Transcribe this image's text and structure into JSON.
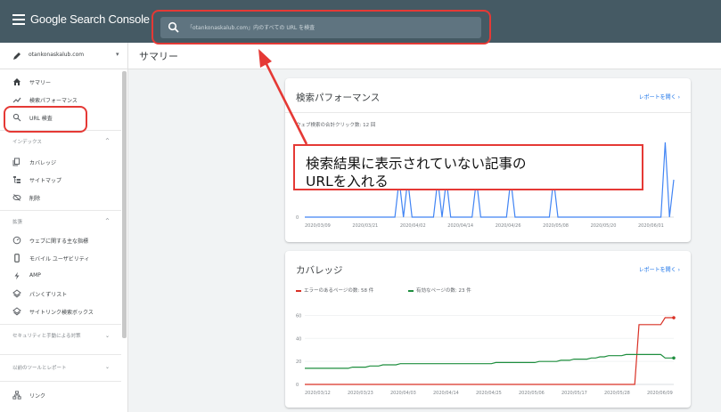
{
  "app": {
    "title": "Google Search Console"
  },
  "search": {
    "placeholder": "「otankonaskalub.com」内のすべての URL を検査"
  },
  "property": {
    "label": "otankonaskalub.com"
  },
  "sidebar": {
    "top_items": [
      {
        "label": "サマリー",
        "icon": "home-icon"
      },
      {
        "label": "検索パフォーマンス",
        "icon": "trending-up-icon"
      },
      {
        "label": "URL 検査",
        "icon": "search-icon"
      }
    ],
    "sections": [
      {
        "label": "インデックス",
        "items": [
          {
            "label": "カバレッジ",
            "icon": "file-copy-icon"
          },
          {
            "label": "サイトマップ",
            "icon": "sitemap-icon"
          },
          {
            "label": "削除",
            "icon": "visibility-off-icon"
          }
        ]
      },
      {
        "label": "拡張",
        "items": [
          {
            "label": "ウェブに関する主な指標",
            "icon": "speed-gauge-icon"
          },
          {
            "label": "モバイル ユーザビリティ",
            "icon": "smartphone-icon"
          },
          {
            "label": "AMP",
            "icon": "amp-bolt-icon"
          },
          {
            "label": "パンくずリスト",
            "icon": "layers-icon"
          },
          {
            "label": "サイトリンク検索ボックス",
            "icon": "layers-icon"
          }
        ]
      },
      {
        "label": "セキュリティと手動による対策"
      },
      {
        "label": "以前のツールとレポート"
      }
    ],
    "bottom_items": [
      {
        "label": "リンク",
        "icon": "links-icon"
      }
    ]
  },
  "main": {
    "title": "サマリー",
    "performance": {
      "title": "検索パフォーマンス",
      "link": "レポートを開く",
      "subtitle": "ウェブ検索の合計クリック数: 12 回"
    },
    "coverage": {
      "title": "カバレッジ",
      "link": "レポートを開く",
      "legend_error": "エラーのあるページの数: 58 件",
      "legend_valid": "有効なページの数: 23 件"
    }
  },
  "callout": {
    "line1": "検索結果に表示されていない記事の",
    "line2": "URLを入れる"
  },
  "colors": {
    "topbar": "#455a64",
    "accent_link": "#1a73e8",
    "annotation_red": "#e53935",
    "perf_line": "#4285f4",
    "error_line": "#d93025",
    "valid_line": "#1e8e3e"
  },
  "chart_data": [
    {
      "type": "line",
      "title": "検索パフォーマンス",
      "series": [
        {
          "name": "ウェブ検索の合計クリック数",
          "values": [
            0,
            0,
            0,
            0,
            0,
            0,
            0,
            0,
            0,
            0,
            0,
            0,
            0,
            0,
            0,
            0,
            0,
            0,
            0,
            0,
            0,
            0,
            1,
            0,
            1,
            0,
            0,
            0,
            0,
            0,
            0,
            1,
            0,
            1,
            0,
            0,
            0,
            0,
            0,
            0,
            1,
            0,
            0,
            0,
            0,
            0,
            0,
            0,
            1,
            0,
            0,
            0,
            0,
            0,
            0,
            0,
            0,
            0,
            1,
            0,
            0,
            0,
            0,
            0,
            0,
            0,
            0,
            0,
            0,
            0,
            0,
            0,
            0,
            0,
            0,
            0,
            0,
            0,
            0,
            0,
            0,
            0,
            0,
            0,
            2,
            0,
            1
          ]
        }
      ],
      "y_ticks": [
        0
      ],
      "x_ticks": [
        "2020/03/09",
        "2020/03/21",
        "2020/04/02",
        "2020/04/14",
        "2020/04/26",
        "2020/05/08",
        "2020/05/20",
        "2020/06/01"
      ]
    },
    {
      "type": "line",
      "title": "カバレッジ",
      "x_ticks": [
        "2020/03/12",
        "2020/03/23",
        "2020/04/03",
        "2020/04/14",
        "2020/04/25",
        "2020/05/06",
        "2020/05/17",
        "2020/05/28",
        "2020/06/09"
      ],
      "y_ticks": [
        0,
        20,
        40,
        60
      ],
      "ylim": [
        0,
        65
      ],
      "series": [
        {
          "name": "エラーのあるページの数",
          "values": [
            0,
            0,
            0,
            0,
            0,
            0,
            0,
            0,
            0,
            0,
            0,
            0,
            0,
            0,
            0,
            0,
            0,
            0,
            0,
            0,
            0,
            0,
            0,
            0,
            0,
            0,
            0,
            0,
            0,
            0,
            0,
            0,
            0,
            0,
            0,
            0,
            0,
            0,
            0,
            0,
            0,
            0,
            0,
            0,
            0,
            0,
            0,
            0,
            0,
            0,
            0,
            0,
            0,
            0,
            0,
            0,
            0,
            0,
            0,
            0,
            0,
            0,
            0,
            0,
            0,
            0,
            0,
            0,
            0,
            0,
            0,
            0,
            0,
            0,
            0,
            0,
            0,
            52,
            52,
            52,
            52,
            52,
            52,
            58,
            58,
            58
          ]
        },
        {
          "name": "有効なページの数",
          "values": [
            14,
            14,
            14,
            14,
            14,
            14,
            14,
            14,
            14,
            14,
            14,
            15,
            15,
            15,
            15,
            16,
            16,
            16,
            17,
            17,
            17,
            17,
            18,
            18,
            18,
            18,
            18,
            18,
            18,
            18,
            18,
            18,
            18,
            18,
            18,
            18,
            18,
            18,
            18,
            18,
            18,
            18,
            18,
            18,
            19,
            19,
            19,
            19,
            19,
            19,
            19,
            19,
            19,
            19,
            20,
            20,
            20,
            20,
            20,
            21,
            21,
            21,
            22,
            22,
            22,
            22,
            23,
            23,
            24,
            24,
            25,
            25,
            25,
            25,
            26,
            26,
            26,
            26,
            26,
            26,
            26,
            26,
            26,
            23,
            23,
            23
          ]
        }
      ]
    }
  ]
}
